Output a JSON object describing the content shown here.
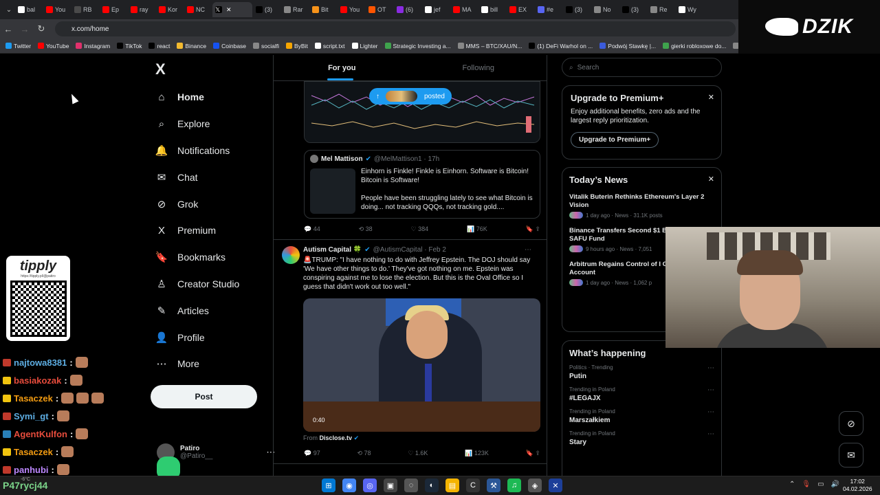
{
  "browser": {
    "tabs": [
      {
        "label": "bal",
        "color": "#ffffff"
      },
      {
        "label": "You",
        "color": "#ff0000"
      },
      {
        "label": "RB",
        "color": "#4a4a4a"
      },
      {
        "label": "Ep",
        "color": "#ff0000"
      },
      {
        "label": "ray",
        "color": "#ff0000"
      },
      {
        "label": "Kor",
        "color": "#ff0000"
      },
      {
        "label": "NC",
        "color": "#ff0000"
      },
      {
        "label": "",
        "color": "#000000",
        "active": true
      },
      {
        "label": "(3)",
        "color": "#000000"
      },
      {
        "label": "Rar",
        "color": "#888888"
      },
      {
        "label": "Bit",
        "color": "#f7931a"
      },
      {
        "label": "You",
        "color": "#ff0000"
      },
      {
        "label": "OT",
        "color": "#ff5500"
      },
      {
        "label": "(6)",
        "color": "#8a2be2"
      },
      {
        "label": "jef",
        "color": "#ffffff"
      },
      {
        "label": "MA",
        "color": "#ff0000"
      },
      {
        "label": "bill",
        "color": "#ffffff"
      },
      {
        "label": "EX",
        "color": "#ff0000"
      },
      {
        "label": "#e",
        "color": "#5865f2"
      },
      {
        "label": "(3)",
        "color": "#000000"
      },
      {
        "label": "No",
        "color": "#888888"
      },
      {
        "label": "(3)",
        "color": "#000000"
      },
      {
        "label": "Re",
        "color": "#888888"
      },
      {
        "label": "Wy",
        "color": "#ffffff"
      }
    ],
    "url": "x.com/home",
    "bookmarks": [
      {
        "label": "Twitter",
        "color": "#1d9bf0"
      },
      {
        "label": "YouTube",
        "color": "#ff0000"
      },
      {
        "label": "Instagram",
        "color": "#e1306c"
      },
      {
        "label": "TikTok",
        "color": "#000000"
      },
      {
        "label": "react",
        "color": "#000000"
      },
      {
        "label": "Binance",
        "color": "#f3ba2f"
      },
      {
        "label": "Coinbase",
        "color": "#1652f0"
      },
      {
        "label": "socialfi",
        "color": "#888888"
      },
      {
        "label": "ByBit",
        "color": "#f7a600"
      },
      {
        "label": "script.txt",
        "color": "#ffffff"
      },
      {
        "label": "Lighter",
        "color": "#ffffff"
      },
      {
        "label": "Strategic Investing a...",
        "color": "#3fa34d"
      },
      {
        "label": "MMS – BTC/XAU/N...",
        "color": "#888888"
      },
      {
        "label": "(1) DeFi Warhol on ...",
        "color": "#000000"
      },
      {
        "label": "Podwój Stawkę |...",
        "color": "#3b5bdb"
      },
      {
        "label": "gierki robloxowe do...",
        "color": "#3fa34d"
      },
      {
        "label": "Calendar | Forex Fac...",
        "color": "#888888"
      }
    ]
  },
  "sidebar": {
    "logo": "X",
    "items": [
      {
        "label": "Home",
        "icon": "home-icon",
        "glyph": "⌂"
      },
      {
        "label": "Explore",
        "icon": "search-icon",
        "glyph": "⌕"
      },
      {
        "label": "Notifications",
        "icon": "bell-icon",
        "glyph": "🔔"
      },
      {
        "label": "Chat",
        "icon": "mail-icon",
        "glyph": "✉"
      },
      {
        "label": "Grok",
        "icon": "grok-icon",
        "glyph": "⊘"
      },
      {
        "label": "Premium",
        "icon": "x-premium-icon",
        "glyph": "X"
      },
      {
        "label": "Bookmarks",
        "icon": "bookmark-icon",
        "glyph": "🔖"
      },
      {
        "label": "Creator Studio",
        "icon": "creator-studio-icon",
        "glyph": "♙"
      },
      {
        "label": "Articles",
        "icon": "articles-icon",
        "glyph": "✎"
      },
      {
        "label": "Profile",
        "icon": "profile-icon",
        "glyph": "👤"
      },
      {
        "label": "More",
        "icon": "more-icon",
        "glyph": "⋯"
      }
    ],
    "post_label": "Post",
    "account": {
      "name": "Patiro",
      "handle": "@Patiro__"
    }
  },
  "feed": {
    "tabs": [
      "For you",
      "Following"
    ],
    "posted_label": "posted",
    "quote": {
      "name": "Mel Mattison",
      "handle": "@MelMattison1 · 17h",
      "text1": "Einhorn is Finkle! Finkle is Einhorn. Software is Bitcoin! Bitcoin is Software!",
      "text2": "People have been struggling lately to see what Bitcoin is doing... not tracking QQQs, not tracking gold...."
    },
    "post1_actions": {
      "replies": "44",
      "reposts": "38",
      "likes": "384",
      "views": "76K"
    },
    "post2": {
      "name": "Autism Capital 🍀",
      "handle": "@AutismCapital · Feb 2",
      "text": "🚨TRUMP: \"I have nothing to do with Jeffrey Epstein. The DOJ should say 'We have other things to do.' They've got nothing on me. Epstein was conspiring against me to lose the election. But this is the Oval Office so I guess that didn't work out too well.\"",
      "video_duration": "0:40",
      "from_label": "From",
      "from_source": "Disclose.tv",
      "actions": {
        "replies": "97",
        "reposts": "78",
        "likes": "1.6K",
        "views": "123K"
      }
    }
  },
  "right": {
    "search_placeholder": "Search",
    "premium": {
      "title": "Upgrade to Premium+",
      "text": "Enjoy additional benefits, zero ads and the largest reply prioritization.",
      "button": "Upgrade to Premium+"
    },
    "news": {
      "title": "Today’s News",
      "items": [
        {
          "headline": "Vitalik Buterin Rethinks Ethereum's Layer 2 Vision",
          "meta": "1 day ago · News · 31.1K posts"
        },
        {
          "headline": "Binance Transfers Second $1 Bitcoin Batch to SAFU Fund",
          "meta": "9 hours ago · News · 7,051"
        },
        {
          "headline": "Arbitrum Regains Control of I Governance Account",
          "meta": "1 day ago · News · 1,062 p"
        }
      ]
    },
    "happening": {
      "title": "What’s happening",
      "trends": [
        {
          "context": "Politics · Trending",
          "topic": "Putin"
        },
        {
          "context": "Trending in Poland",
          "topic": "#LEGAJX"
        },
        {
          "context": "Trending in Poland",
          "topic": "Marszałkiem"
        },
        {
          "context": "Trending in Poland",
          "topic": "Stary"
        }
      ]
    }
  },
  "overlay": {
    "brand": "DZIK",
    "tipply_title": "tipply",
    "tipply_url": "https://tipply.pl/@patiro",
    "chat": [
      {
        "user": "najtowa8381",
        "color": "#5dade2",
        "badge": "r",
        "emotes": 1
      },
      {
        "user": "basiakozak",
        "color": "#e74c3c",
        "badge": "y",
        "emotes": 1
      },
      {
        "user": "Tasaczek",
        "color": "#f39c12",
        "badge": "y",
        "emotes": 3
      },
      {
        "user": "Symi_gt",
        "color": "#5dade2",
        "badge": "r",
        "emotes": 1
      },
      {
        "user": "AgentKulfon",
        "color": "#e74c3c",
        "badge": "b",
        "emotes": 1
      },
      {
        "user": "Tasaczek",
        "color": "#f39c12",
        "badge": "y",
        "emotes": 1
      },
      {
        "user": "panhubi",
        "color": "#bb86fc",
        "badge": "r",
        "emotes": 1
      }
    ],
    "bottom_user": "P47rycj44",
    "sub_count": "k1075"
  },
  "taskbar": {
    "clock_time": "17:02",
    "clock_date": "04.02.2026",
    "weather": "-6°C"
  }
}
